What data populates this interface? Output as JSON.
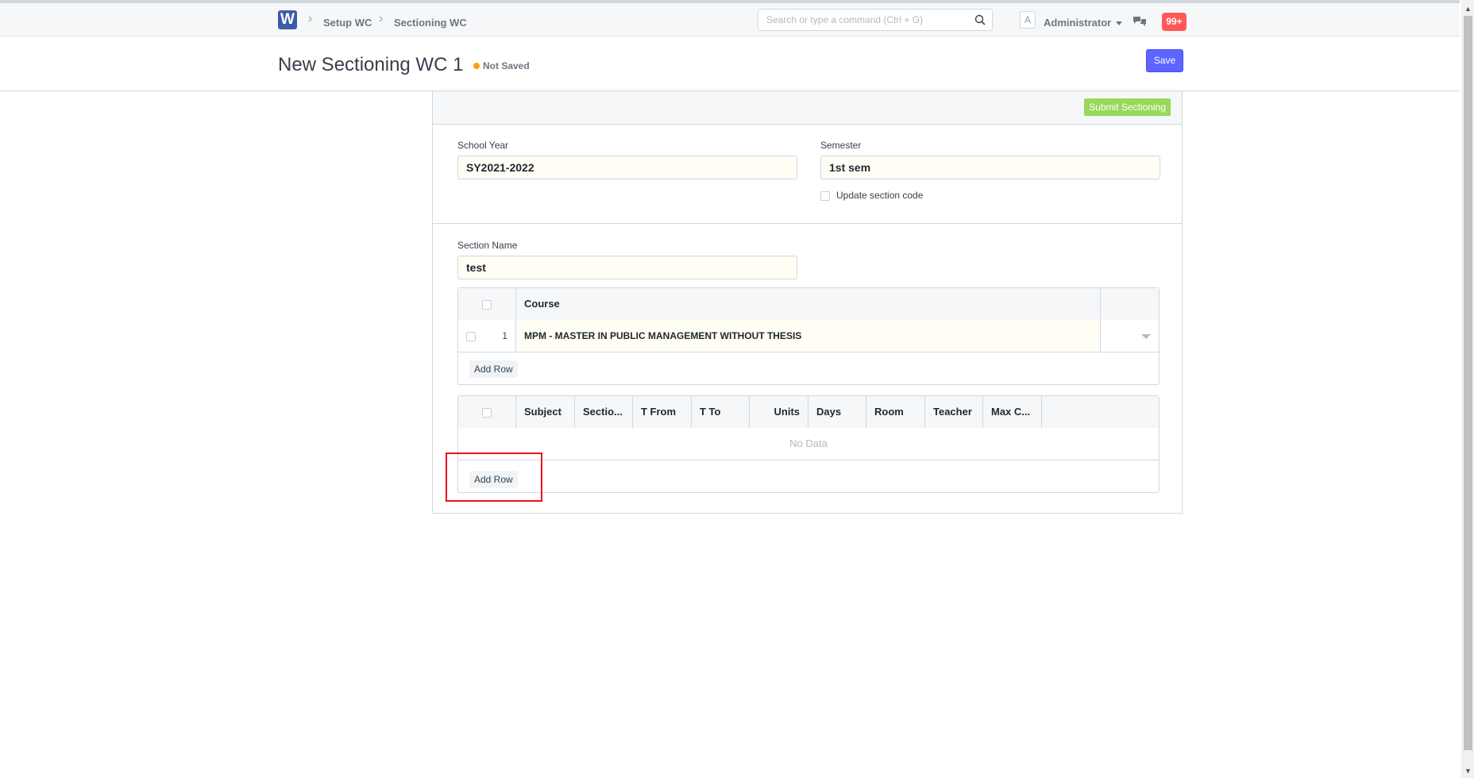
{
  "navbar": {
    "logo_letter": "W",
    "breadcrumbs": [
      "Setup WC",
      "Sectioning WC"
    ],
    "search_placeholder": "Search or type a command (Ctrl + G)",
    "avatar_letter": "A",
    "user_name": "Administrator",
    "notification_count": "99+"
  },
  "page": {
    "title": "New Sectioning WC 1",
    "status": "Not Saved",
    "save_label": "Save",
    "status_color": "#ffa00a"
  },
  "form": {
    "submit_label": "Submit Sectioning",
    "school_year": {
      "label": "School Year",
      "value": "SY2021-2022"
    },
    "semester": {
      "label": "Semester",
      "value": "1st sem"
    },
    "update_section_code_label": "Update section code",
    "section_name": {
      "label": "Section Name",
      "value": "test"
    }
  },
  "course_table": {
    "columns": [
      "Course"
    ],
    "rows": [
      {
        "index": "1",
        "course": "MPM - MASTER IN PUBLIC MANAGEMENT WITHOUT THESIS"
      }
    ],
    "add_row_label": "Add Row"
  },
  "subject_table": {
    "columns": [
      "Subject",
      "Sectio...",
      "T From",
      "T To",
      "Units",
      "Days",
      "Room",
      "Teacher",
      "Max C..."
    ],
    "empty_text": "No Data",
    "add_row_label": "Add Row"
  }
}
